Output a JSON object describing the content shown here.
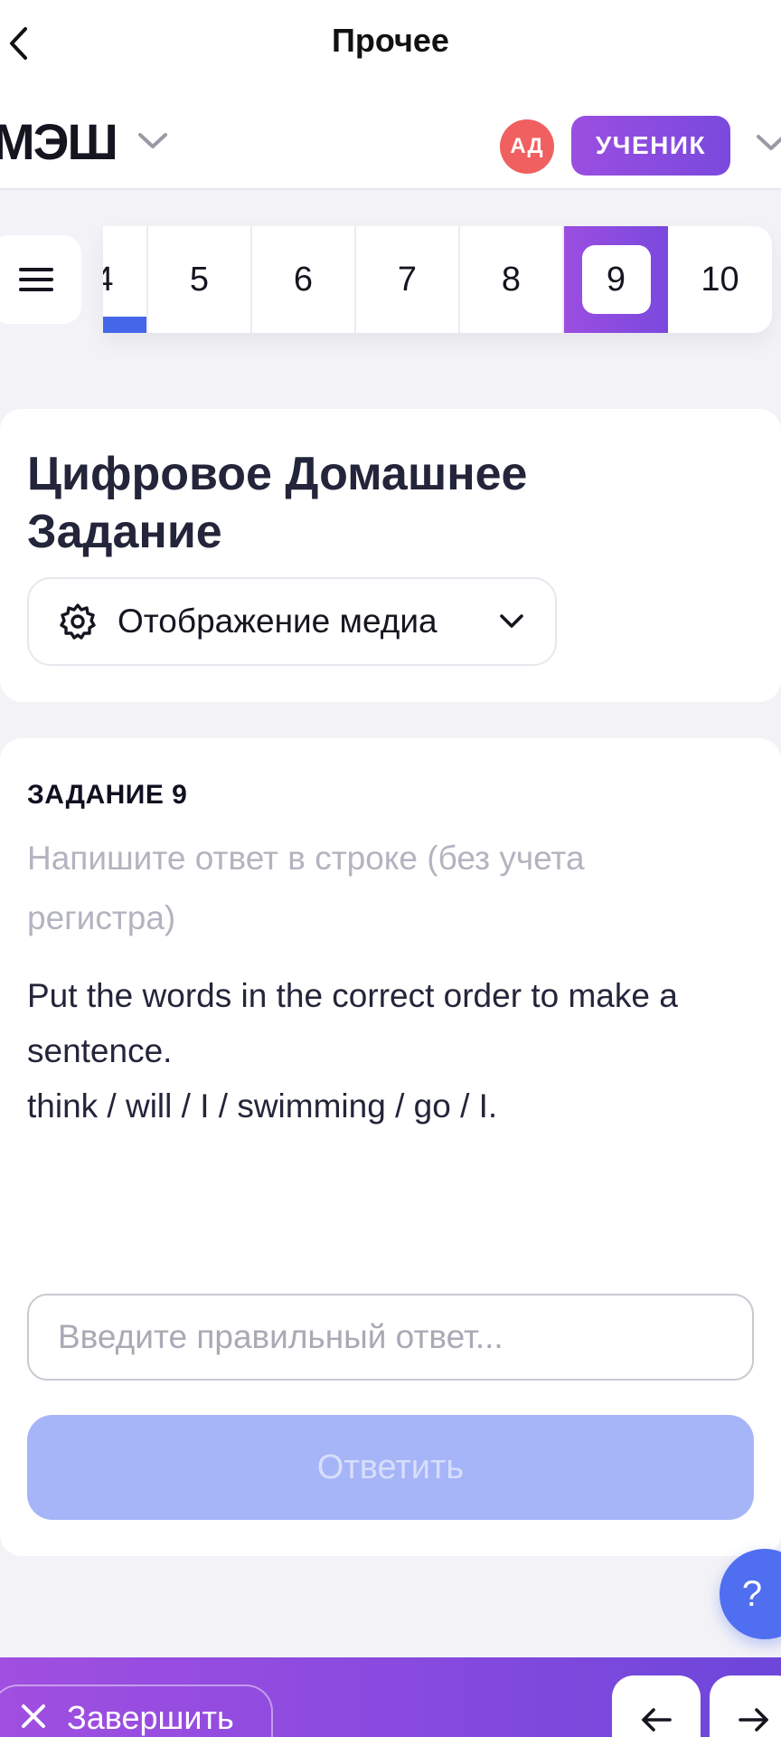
{
  "topbar": {
    "title": "Прочее"
  },
  "header": {
    "logo": "МЭШ",
    "avatar_initials": "АД",
    "role": "УЧЕНИК"
  },
  "pager": {
    "items": [
      {
        "label": "4",
        "state": "partial"
      },
      {
        "label": "5",
        "state": "normal"
      },
      {
        "label": "6",
        "state": "normal"
      },
      {
        "label": "7",
        "state": "normal"
      },
      {
        "label": "8",
        "state": "normal"
      },
      {
        "label": "9",
        "state": "active"
      },
      {
        "label": "10",
        "state": "normal"
      }
    ]
  },
  "title_card": {
    "title": "Цифровое Домашнее Задание",
    "media_select_label": "Отображение медиа"
  },
  "task": {
    "number": "ЗАДАНИЕ 9",
    "instruction": "Напишите ответ в строке (без учета регистра)",
    "text_line1": "Put the words in the correct order to make a sentence.",
    "text_line2": "think / will / I / swimming / go / I.",
    "input_placeholder": "Введите правильный ответ...",
    "submit_label": "Ответить"
  },
  "help": {
    "label": "?"
  },
  "bottombar": {
    "finish_label": "Завершить"
  },
  "colors": {
    "accent_purple": "#8a4adf",
    "accent_blue": "#4566e8",
    "submit_disabled": "#a6b5f8",
    "avatar": "#f06060"
  }
}
